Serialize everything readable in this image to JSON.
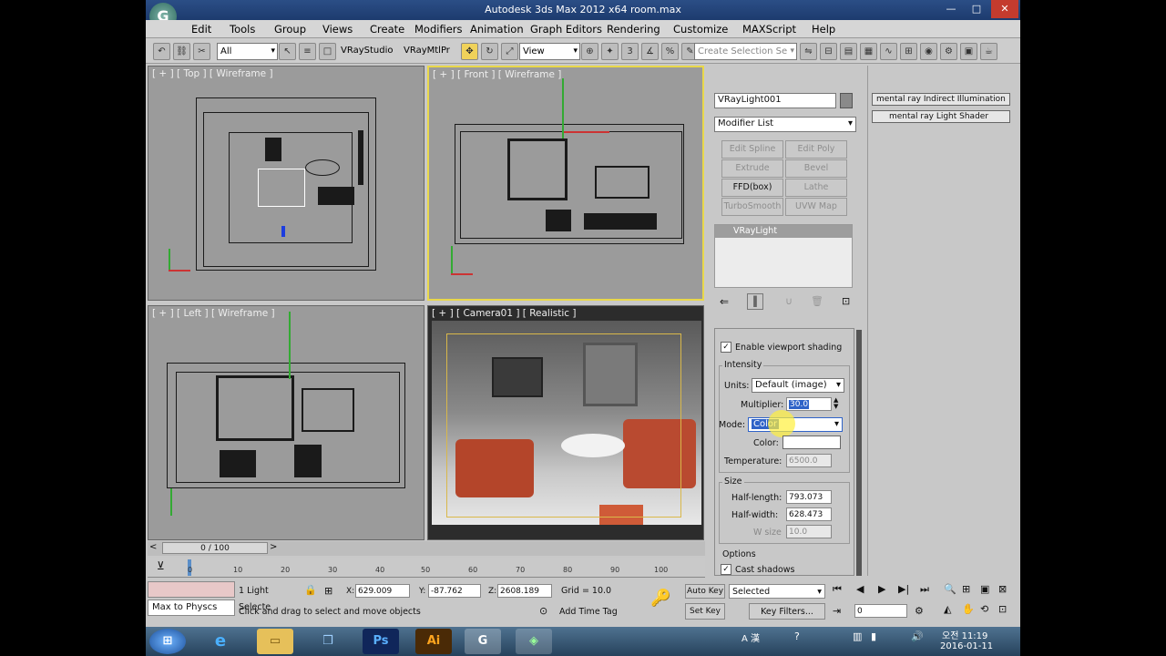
{
  "window": {
    "title": "Autodesk 3ds Max  2012 x64     room.max",
    "app_icon_glyph": "G",
    "minimize": "—",
    "maximize": "□",
    "close": "✕"
  },
  "menu": [
    "Edit",
    "Tools",
    "Group",
    "Views",
    "Create",
    "Modifiers",
    "Animation",
    "Graph Editors",
    "Rendering",
    "Customize",
    "MAXScript",
    "Help"
  ],
  "toolbar": {
    "filter_select": "All",
    "vray_studio": "VRayStudio",
    "vray_mtl": "VRayMtlPr",
    "ref_coord": "View",
    "selection_set_placeholder": "Create Selection Se"
  },
  "viewports": {
    "top": "[ + ] [ Top ] [ Wireframe ]",
    "front": "[ + ] [ Front ] [ Wireframe ]",
    "left": "[ + ] [ Left ] [ Wireframe ]",
    "camera": "[ + ] [ Camera01 ] [ Realistic ]"
  },
  "command_panel": {
    "object_name": "VRayLight001",
    "modifier_list": "Modifier List",
    "buttons": [
      "Edit Spline",
      "Edit Poly",
      "Extrude",
      "Bevel",
      "FFD(box)",
      "Lathe",
      "TurboSmooth",
      "UVW Map"
    ],
    "stack_item": "VRayLight",
    "enable_viewport_shading": "Enable viewport shading",
    "intensity_group": "Intensity",
    "units_label": "Units:",
    "units_value": "Default (image)",
    "multiplier_label": "Multiplier:",
    "multiplier_value": "30.0",
    "mode_label": "Mode:",
    "mode_value": "Color",
    "color_label": "Color:",
    "temperature_label": "Temperature:",
    "temperature_value": "6500.0",
    "size_group": "Size",
    "half_length_label": "Half-length:",
    "half_length_value": "793.073",
    "half_width_label": "Half-width:",
    "half_width_value": "628.473",
    "w_size_label": "W size",
    "w_size_value": "10.0",
    "options_group": "Options",
    "cast_shadows": "Cast shadows"
  },
  "right_panel": {
    "item1": "mental ray Indirect Illumination",
    "item2": "mental ray Light Shader"
  },
  "timeline": {
    "frame_counter": "0 / 100",
    "ticks": [
      "0",
      "10",
      "20",
      "30",
      "40",
      "50",
      "60",
      "70",
      "80",
      "90",
      "100"
    ]
  },
  "status": {
    "max_to_physics": "Max to Physcs",
    "selection_info": "1 Light Selecte",
    "x_label": "X:",
    "x_value": "629.009",
    "y_label": "Y:",
    "y_value": "-87.762",
    "z_label": "Z:",
    "z_value": "2608.189",
    "grid": "Grid = 10.0",
    "prompt": "Click and drag to select and move objects",
    "add_time_tag": "Add Time Tag",
    "auto_key": "Auto Key",
    "selected": "Selected",
    "set_key": "Set Key",
    "key_filters": "Key Filters...",
    "frame_value": "0"
  },
  "taskbar": {
    "tray_lang": "A 漢",
    "time_period": "오전 11:19",
    "date": "2016-01-11"
  }
}
